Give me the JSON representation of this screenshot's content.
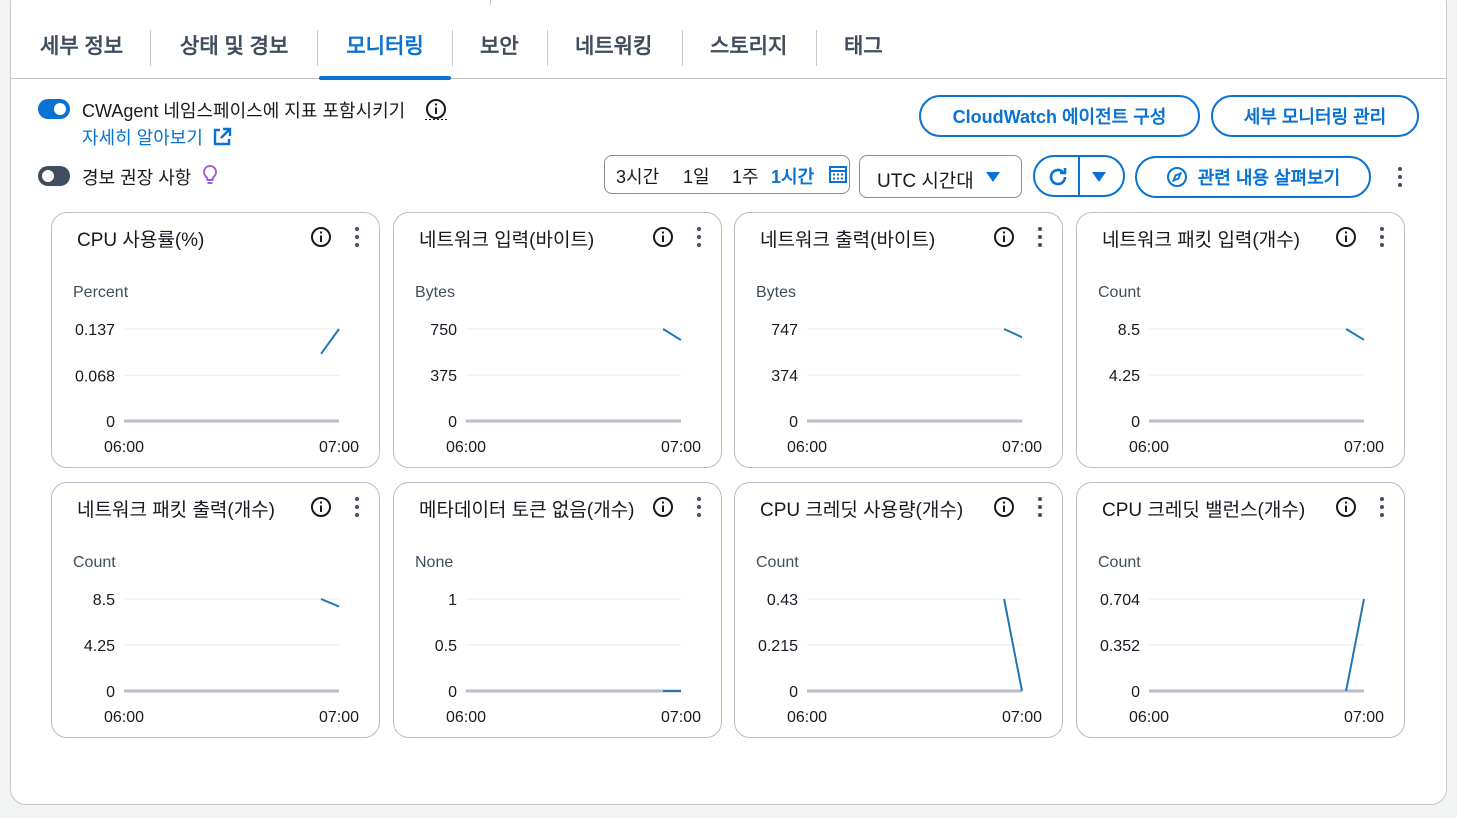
{
  "tabs": [
    {
      "label": "세부 정보"
    },
    {
      "label": "상태 및 경보"
    },
    {
      "label": "모니터링"
    },
    {
      "label": "보안"
    },
    {
      "label": "네트워킹"
    },
    {
      "label": "스토리지"
    },
    {
      "label": "태그"
    }
  ],
  "active_tab": "모니터링",
  "cwagent": {
    "toggle_on": true,
    "label": "CWAgent 네임스페이스에 지표 포함시키기",
    "learn_more": "자세히 알아보기"
  },
  "alarm_reco": {
    "toggle_on": false,
    "label": "경보 권장 사항"
  },
  "buttons": {
    "cloudwatch_agent": "CloudWatch 에이전트 구성",
    "detailed_monitoring": "세부 모니터링 관리",
    "explore_related": "관련 내용 살펴보기"
  },
  "time_range": {
    "options": [
      "3시간",
      "1일",
      "1주",
      "1시간"
    ],
    "selected": "1시간"
  },
  "timezone": {
    "value": "UTC 시간대"
  },
  "colors": {
    "accent": "#0972d3",
    "series": "#1f77b4",
    "text": "#16191f",
    "muted": "#414d5c"
  },
  "widgets": [
    {
      "title": "CPU 사용률(%)",
      "unit": "Percent",
      "yticks": [
        "0.137",
        "0.068",
        "0"
      ],
      "xticks": [
        "06:00",
        "07:00"
      ],
      "chart_data": {
        "type": "line",
        "x": [
          "06:55",
          "07:00"
        ],
        "y": [
          0.1,
          0.137
        ],
        "ylim": [
          0,
          0.137
        ]
      }
    },
    {
      "title": "네트워크 입력(바이트)",
      "unit": "Bytes",
      "yticks": [
        "750",
        "375",
        "0"
      ],
      "xticks": [
        "06:00",
        "07:00"
      ],
      "chart_data": {
        "type": "line",
        "x": [
          "06:55",
          "07:00"
        ],
        "y": [
          750,
          660
        ],
        "ylim": [
          0,
          750
        ]
      }
    },
    {
      "title": "네트워크 출력(바이트)",
      "unit": "Bytes",
      "yticks": [
        "747",
        "374",
        "0"
      ],
      "xticks": [
        "06:00",
        "07:00"
      ],
      "chart_data": {
        "type": "line",
        "x": [
          "06:55",
          "07:00"
        ],
        "y": [
          747,
          680
        ],
        "ylim": [
          0,
          747
        ]
      }
    },
    {
      "title": "네트워크 패킷 입력(개수)",
      "unit": "Count",
      "yticks": [
        "8.5",
        "4.25",
        "0"
      ],
      "xticks": [
        "06:00",
        "07:00"
      ],
      "chart_data": {
        "type": "line",
        "x": [
          "06:55",
          "07:00"
        ],
        "y": [
          8.5,
          7.5
        ],
        "ylim": [
          0,
          8.5
        ]
      }
    },
    {
      "title": "네트워크 패킷 출력(개수)",
      "unit": "Count",
      "yticks": [
        "8.5",
        "4.25",
        "0"
      ],
      "xticks": [
        "06:00",
        "07:00"
      ],
      "chart_data": {
        "type": "line",
        "x": [
          "06:55",
          "07:00"
        ],
        "y": [
          8.5,
          7.8
        ],
        "ylim": [
          0,
          8.5
        ]
      }
    },
    {
      "title": "메타데이터 토큰 없음(개수)",
      "unit": "None",
      "yticks": [
        "1",
        "0.5",
        "0"
      ],
      "xticks": [
        "06:00",
        "07:00"
      ],
      "chart_data": {
        "type": "line",
        "x": [
          "06:55",
          "07:00"
        ],
        "y": [
          0,
          0
        ],
        "ylim": [
          0,
          1
        ]
      }
    },
    {
      "title": "CPU 크레딧 사용량(개수)",
      "unit": "Count",
      "yticks": [
        "0.43",
        "0.215",
        "0"
      ],
      "xticks": [
        "06:00",
        "07:00"
      ],
      "chart_data": {
        "type": "line",
        "x": [
          "06:55",
          "07:00"
        ],
        "y": [
          0.43,
          0
        ],
        "ylim": [
          0,
          0.43
        ]
      }
    },
    {
      "title": "CPU 크레딧 밸런스(개수)",
      "unit": "Count",
      "yticks": [
        "0.704",
        "0.352",
        "0"
      ],
      "xticks": [
        "06:00",
        "07:00"
      ],
      "chart_data": {
        "type": "line",
        "x": [
          "06:55",
          "07:00"
        ],
        "y": [
          0,
          0.704
        ],
        "ylim": [
          0,
          0.704
        ]
      }
    }
  ]
}
